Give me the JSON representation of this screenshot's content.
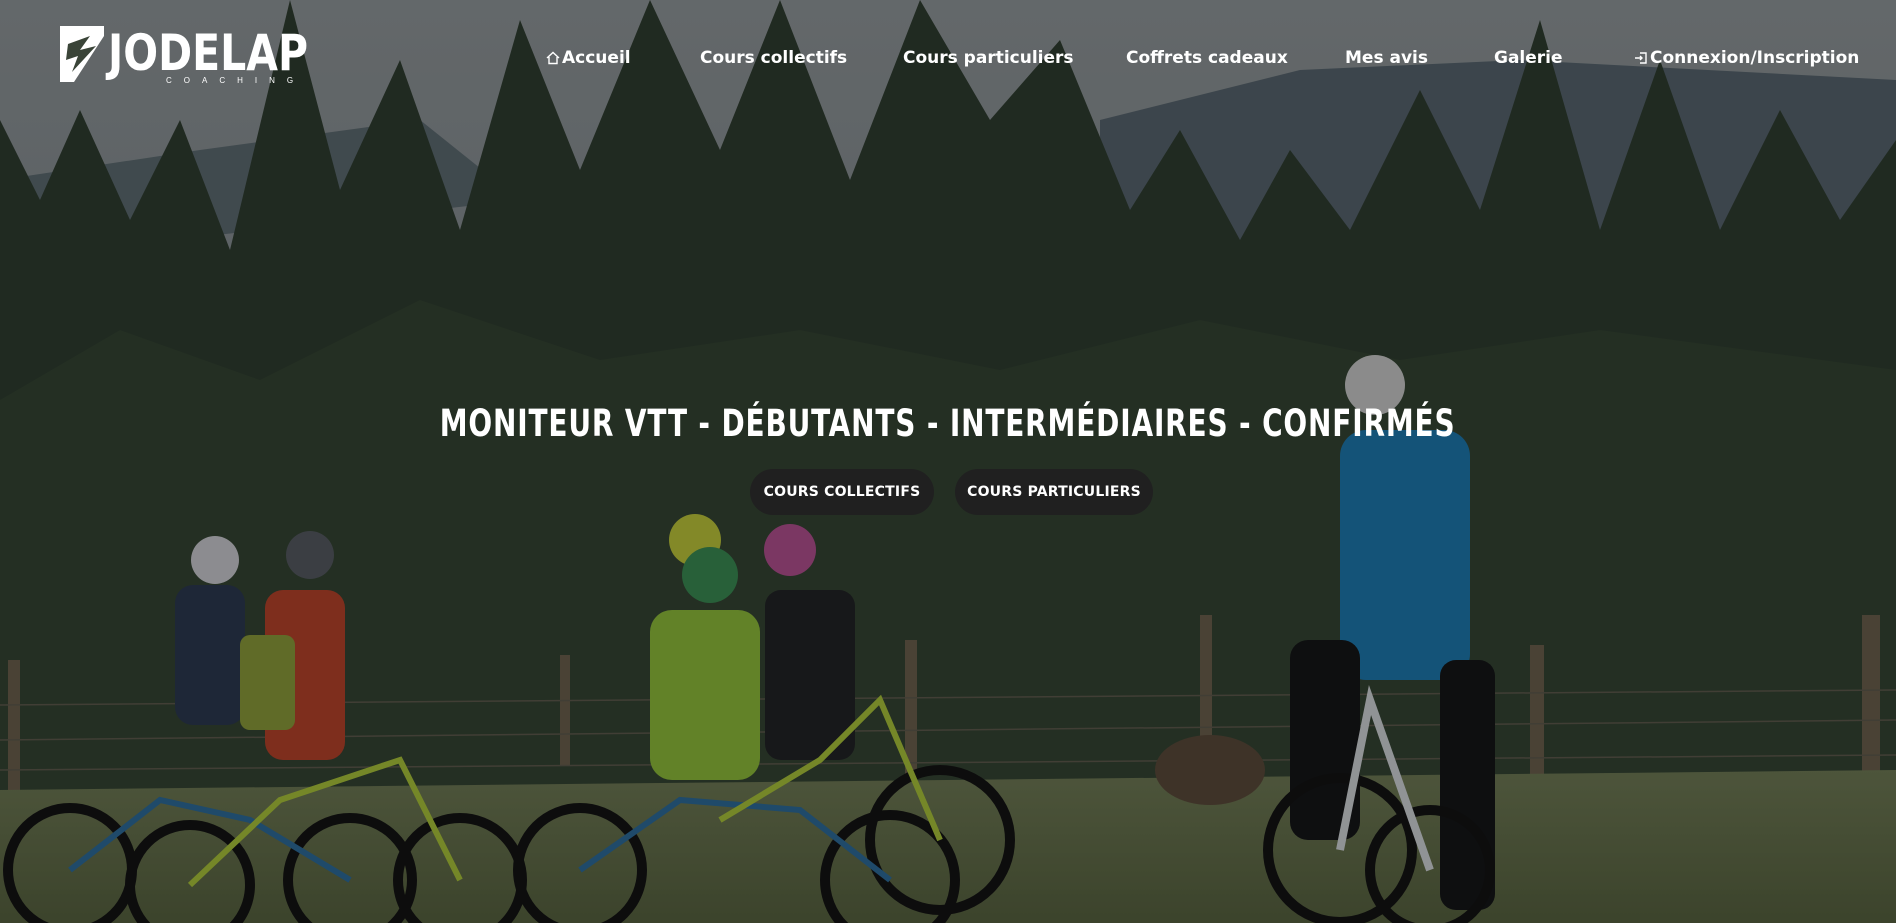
{
  "brand": {
    "name": "JODELAP",
    "tagline": "COACHING"
  },
  "nav": {
    "items": [
      {
        "label": "Accueil",
        "icon": "home-icon"
      },
      {
        "label": "Cours collectifs"
      },
      {
        "label": "Cours particuliers"
      },
      {
        "label": "Coffrets cadeaux"
      },
      {
        "label": "Mes avis"
      },
      {
        "label": "Galerie"
      },
      {
        "label": "Connexion/Inscription",
        "icon": "login-icon"
      }
    ]
  },
  "hero": {
    "headline": "MONITEUR VTT - DÉBUTANTS - INTERMÉDIAIRES - CONFIRMÉS",
    "cta_primary": "COURS COLLECTIFS",
    "cta_secondary": "COURS PARTICULIERS",
    "image_icon": "photo-kids-mountain-biking"
  },
  "colors": {
    "button_bg": "#202020",
    "text": "#ffffff",
    "overlay": "rgba(0,0,0,0.35)"
  }
}
